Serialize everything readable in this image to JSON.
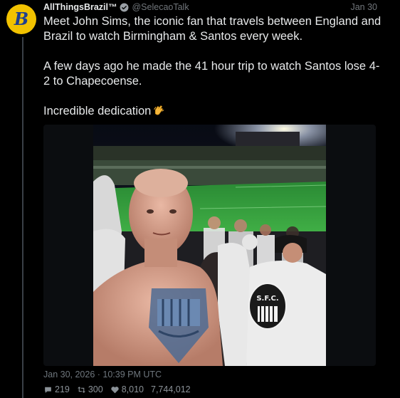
{
  "tweet": {
    "display_name": "AllThingsBrazil™",
    "handle": "@SelecaoTalk",
    "date": "Jan 30",
    "avatar_letter": "B",
    "paragraphs": [
      "Meet John Sims, the iconic fan that travels between England and Brazil to watch Birmingham & Santos every week.",
      "A few days ago he made the 41 hour trip to watch Santos lose 4-2 to Chapecoense.",
      "Incredible dedication"
    ],
    "timestamp": "Jan 30, 2026 · 10:39 PM UTC",
    "stats": {
      "replies": "219",
      "retweets": "300",
      "likes": "8,010",
      "views": "7,744,012"
    }
  },
  "colors": {
    "background": "#000000",
    "text": "#e7e9ea",
    "muted": "#71767b",
    "avatar": "#f2c200",
    "verified": "#1d9bf0"
  },
  "icons": {
    "verified": "verified-badge-icon",
    "clap": "clapping-hands-icon",
    "reply": "reply-icon",
    "retweet": "retweet-icon",
    "like": "heart-icon"
  }
}
